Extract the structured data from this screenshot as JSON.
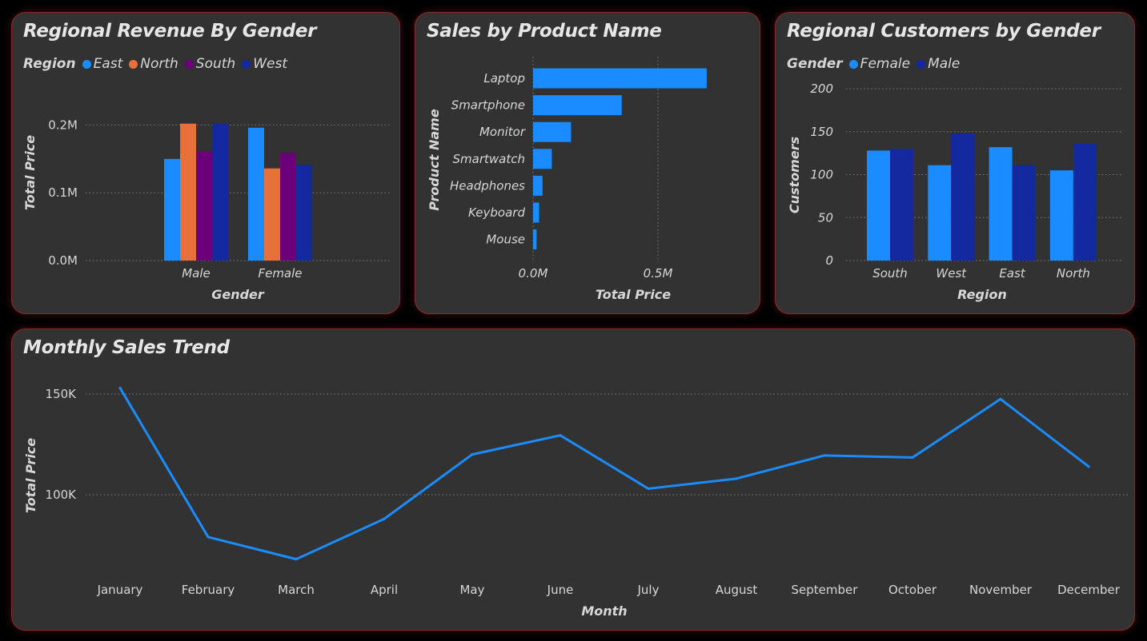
{
  "colors": {
    "east": "#1a8cff",
    "north": "#e8703a",
    "south": "#6b007a",
    "west": "#1428a0",
    "female": "#1a8cff",
    "male": "#1428a0",
    "bar": "#1a8cff",
    "line": "#1a8cff"
  },
  "revenue_card": {
    "title": "Regional Revenue By Gender",
    "legend_title": "Region",
    "legend": [
      "East",
      "North",
      "South",
      "West"
    ]
  },
  "product_card": {
    "title": "Sales by Product Name"
  },
  "customers_card": {
    "title": "Regional Customers by Gender",
    "legend_title": "Gender",
    "legend": [
      "Female",
      "Male"
    ]
  },
  "trend_card": {
    "title": "Monthly Sales Trend"
  },
  "chart_data": [
    {
      "type": "bar",
      "title": "Regional Revenue By Gender",
      "xlabel": "Gender",
      "ylabel": "Total Price",
      "categories": [
        "Male",
        "Female"
      ],
      "series": [
        {
          "name": "East",
          "values": [
            150000,
            196000
          ]
        },
        {
          "name": "North",
          "values": [
            202000,
            136000
          ]
        },
        {
          "name": "South",
          "values": [
            161000,
            159000
          ]
        },
        {
          "name": "West",
          "values": [
            202000,
            141000
          ]
        }
      ],
      "ylim": [
        0,
        230000
      ],
      "yticks": [
        0,
        100000,
        200000
      ],
      "ytick_labels": [
        "0.0M",
        "0.1M",
        "0.2M"
      ],
      "legend": "top-left",
      "grid": true
    },
    {
      "type": "bar",
      "orientation": "horizontal",
      "title": "Sales by Product Name",
      "xlabel": "Total Price",
      "ylabel": "Product Name",
      "categories": [
        "Laptop",
        "Smartphone",
        "Monitor",
        "Smartwatch",
        "Headphones",
        "Keyboard",
        "Mouse"
      ],
      "values": [
        695000,
        355000,
        152000,
        75000,
        38000,
        24000,
        14000
      ],
      "xlim": [
        0,
        1000000
      ],
      "xticks": [
        0,
        500000
      ],
      "xtick_labels": [
        "0.0M",
        "0.5M"
      ],
      "grid": true
    },
    {
      "type": "bar",
      "title": "Regional Customers by Gender",
      "xlabel": "Region",
      "ylabel": "Customers",
      "categories": [
        "South",
        "West",
        "East",
        "North"
      ],
      "series": [
        {
          "name": "Female",
          "values": [
            128,
            111,
            132,
            105
          ]
        },
        {
          "name": "Male",
          "values": [
            130,
            148,
            111,
            136
          ]
        }
      ],
      "ylim": [
        0,
        200
      ],
      "yticks": [
        0,
        50,
        100,
        150,
        200
      ],
      "ytick_labels": [
        "0",
        "50",
        "100",
        "150",
        "200"
      ],
      "legend": "top-left",
      "grid": true
    },
    {
      "type": "line",
      "title": "Monthly Sales Trend",
      "xlabel": "Month",
      "ylabel": "Total Price",
      "categories": [
        "January",
        "February",
        "March",
        "April",
        "May",
        "June",
        "July",
        "August",
        "September",
        "October",
        "November",
        "December"
      ],
      "values": [
        153000,
        79000,
        68000,
        88000,
        120000,
        129500,
        103000,
        108000,
        119500,
        118500,
        147500,
        114000
      ],
      "ylim": [
        65000,
        155000
      ],
      "yticks": [
        100000,
        150000
      ],
      "ytick_labels": [
        "100K",
        "150K"
      ],
      "grid": true
    }
  ]
}
